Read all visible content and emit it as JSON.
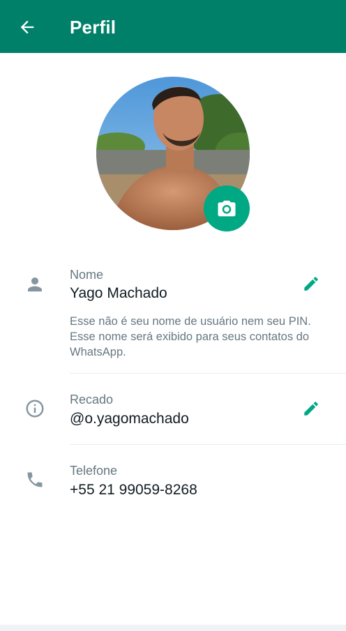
{
  "appbar": {
    "title": "Perfil",
    "background_color": "#008069",
    "back_icon": "arrow-left-icon"
  },
  "profile_photo": {
    "camera_icon": "camera-icon",
    "camera_button_color": "#00a884"
  },
  "name_row": {
    "icon": "person-icon",
    "label": "Nome",
    "value": "Yago Machado",
    "edit_icon": "pencil-icon",
    "hint": "Esse não é seu nome de usuário nem seu PIN. Esse nome será exibido para seus contatos do WhatsApp."
  },
  "about_row": {
    "icon": "info-icon",
    "label": "Recado",
    "value": "@o.yagomachado",
    "edit_icon": "pencil-icon"
  },
  "phone_row": {
    "icon": "phone-icon",
    "label": "Telefone",
    "value": "+55 21 99059-8268"
  },
  "colors": {
    "accent": "#00a884",
    "icon_gray": "#8696a0",
    "label_gray": "#667781"
  }
}
